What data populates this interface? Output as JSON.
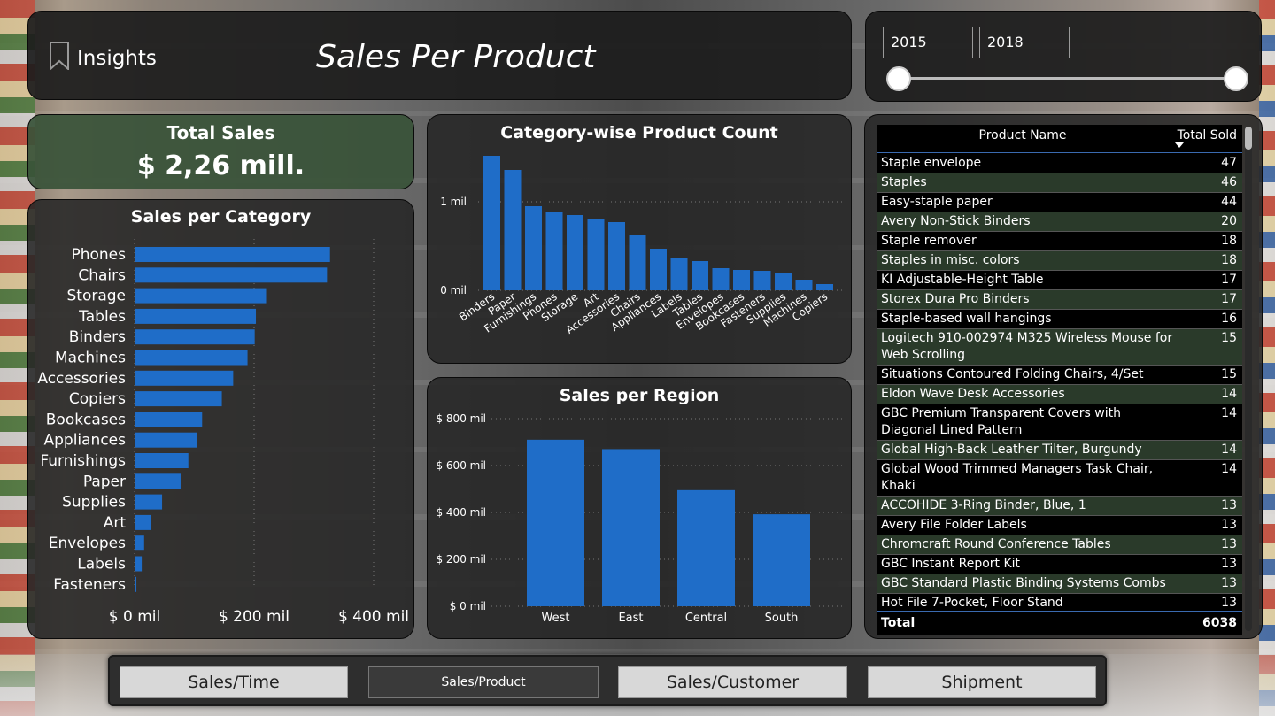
{
  "header": {
    "app_label": "Insights",
    "page_title": "Sales Per Product"
  },
  "slicer": {
    "start_year": "2015",
    "end_year": "2018"
  },
  "kpi": {
    "label": "Total Sales",
    "value": "$ 2,26 mill."
  },
  "charts": {
    "category_title": "Sales per Category",
    "count_title": "Category-wise Product Count",
    "region_title": "Sales per Region"
  },
  "chart_data": [
    {
      "type": "bar",
      "orientation": "horizontal",
      "title": "Sales per Category",
      "categories": [
        "Phones",
        "Chairs",
        "Storage",
        "Tables",
        "Binders",
        "Machines",
        "Accessories",
        "Copiers",
        "Bookcases",
        "Appliances",
        "Furnishings",
        "Paper",
        "Supplies",
        "Art",
        "Envelopes",
        "Labels",
        "Fasteners"
      ],
      "values": [
        327,
        322,
        220,
        203,
        201,
        189,
        165,
        146,
        113,
        104,
        90,
        77,
        46,
        27,
        16,
        12,
        3
      ],
      "xticks": [
        "$ 0 mil",
        "$ 200 mil",
        "$ 400 mil"
      ],
      "xlim": [
        0,
        400
      ],
      "grid": true
    },
    {
      "type": "bar",
      "title": "Category-wise Product Count",
      "categories": [
        "Binders",
        "Paper",
        "Furnishings",
        "Phones",
        "Storage",
        "Art",
        "Accessories",
        "Chairs",
        "Appliances",
        "Labels",
        "Tables",
        "Envelopes",
        "Bookcases",
        "Fasteners",
        "Supplies",
        "Machines",
        "Copiers"
      ],
      "values": [
        1.52,
        1.36,
        0.95,
        0.89,
        0.85,
        0.8,
        0.77,
        0.62,
        0.47,
        0.37,
        0.33,
        0.25,
        0.23,
        0.22,
        0.19,
        0.12,
        0.07
      ],
      "yticks": [
        "1 mil",
        "0 mil"
      ],
      "ylim": [
        0,
        1.6
      ],
      "grid": true
    },
    {
      "type": "bar",
      "title": "Sales per Region",
      "categories": [
        "West",
        "East",
        "Central",
        "South"
      ],
      "values": [
        710,
        670,
        495,
        392
      ],
      "yticks": [
        "$ 800 mil",
        "$ 600 mil",
        "$ 400 mil",
        "$ 200 mil",
        "$ 0 mil"
      ],
      "ylim": [
        0,
        800
      ],
      "grid": true
    }
  ],
  "table": {
    "col_name": "Product Name",
    "col_sold": "Total Sold",
    "rows": [
      {
        "name": "Staple envelope",
        "sold": "47"
      },
      {
        "name": "Staples",
        "sold": "46"
      },
      {
        "name": "Easy-staple paper",
        "sold": "44"
      },
      {
        "name": "Avery Non-Stick Binders",
        "sold": "20"
      },
      {
        "name": "Staple remover",
        "sold": "18"
      },
      {
        "name": "Staples in misc. colors",
        "sold": "18"
      },
      {
        "name": "KI Adjustable-Height Table",
        "sold": "17"
      },
      {
        "name": "Storex Dura Pro Binders",
        "sold": "17"
      },
      {
        "name": "Staple-based wall hangings",
        "sold": "16"
      },
      {
        "name": "Logitech 910-002974 M325 Wireless Mouse for Web Scrolling",
        "sold": "15"
      },
      {
        "name": "Situations Contoured Folding Chairs, 4/Set",
        "sold": "15"
      },
      {
        "name": "Eldon Wave Desk Accessories",
        "sold": "14"
      },
      {
        "name": "GBC Premium Transparent Covers with Diagonal Lined Pattern",
        "sold": "14"
      },
      {
        "name": "Global High-Back Leather Tilter, Burgundy",
        "sold": "14"
      },
      {
        "name": "Global Wood Trimmed Managers Task Chair, Khaki",
        "sold": "14"
      },
      {
        "name": "ACCOHIDE 3-Ring Binder, Blue, 1",
        "sold": "13"
      },
      {
        "name": "Avery File Folder Labels",
        "sold": "13"
      },
      {
        "name": "Chromcraft Round Conference Tables",
        "sold": "13"
      },
      {
        "name": "GBC Instant Report Kit",
        "sold": "13"
      },
      {
        "name": "GBC Standard Plastic Binding Systems Combs",
        "sold": "13"
      },
      {
        "name": "Hot File 7-Pocket, Floor Stand",
        "sold": "13"
      }
    ],
    "total_label": "Total",
    "total_value": "6038"
  },
  "nav": {
    "items": [
      "Sales/Time",
      "Sales/Product",
      "Sales/Customer",
      "Shipment"
    ],
    "active": "Sales/Product"
  },
  "colors": {
    "bar": "#1f6dc8",
    "panel": "#262626",
    "kpi_panel": "#385238"
  }
}
